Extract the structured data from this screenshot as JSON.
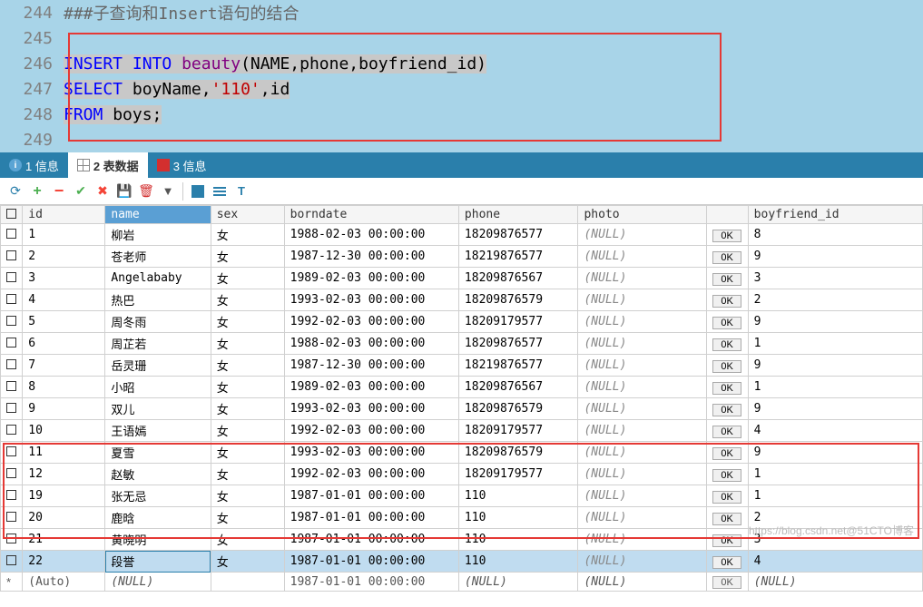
{
  "editor": {
    "lines": [
      {
        "num": "244",
        "tokens": [
          {
            "t": "###子查询和Insert语句的结合",
            "cls": "comment-gray"
          }
        ]
      },
      {
        "num": "245",
        "tokens": []
      },
      {
        "num": "246",
        "tokens": [
          {
            "t": "INSERT INTO",
            "cls": "kw-blue sel"
          },
          {
            "t": " ",
            "cls": "sel"
          },
          {
            "t": "beauty",
            "cls": "kw-purple sel"
          },
          {
            "t": "(NAME,phone,boyfriend_id)",
            "cls": "sel"
          }
        ]
      },
      {
        "num": "247",
        "tokens": [
          {
            "t": "SELECT",
            "cls": "kw-blue sel"
          },
          {
            "t": " boyName,",
            "cls": "sel"
          },
          {
            "t": "'110'",
            "cls": "kw-red sel"
          },
          {
            "t": ",id",
            "cls": "sel"
          }
        ]
      },
      {
        "num": "248",
        "tokens": [
          {
            "t": "FROM",
            "cls": "kw-blue sel"
          },
          {
            "t": " boys;",
            "cls": "sel"
          }
        ]
      },
      {
        "num": "249",
        "tokens": []
      }
    ]
  },
  "tabs": {
    "t1": "1 信息",
    "t2": "2 表数据",
    "t3": "3 信息"
  },
  "headers": {
    "id": "id",
    "name": "name",
    "sex": "sex",
    "borndate": "borndate",
    "phone": "phone",
    "photo": "photo",
    "boyfriend_id": "boyfriend_id"
  },
  "ok_label": "0K",
  "rows": [
    {
      "id": "1",
      "name": "柳岩",
      "sex": "女",
      "borndate": "1988-02-03 00:00:00",
      "phone": "18209876577",
      "photo": "(NULL)",
      "bf": "8"
    },
    {
      "id": "2",
      "name": "苍老师",
      "sex": "女",
      "borndate": "1987-12-30 00:00:00",
      "phone": "18219876577",
      "photo": "(NULL)",
      "bf": "9"
    },
    {
      "id": "3",
      "name": "Angelababy",
      "sex": "女",
      "borndate": "1989-02-03 00:00:00",
      "phone": "18209876567",
      "photo": "(NULL)",
      "bf": "3"
    },
    {
      "id": "4",
      "name": "热巴",
      "sex": "女",
      "borndate": "1993-02-03 00:00:00",
      "phone": "18209876579",
      "photo": "(NULL)",
      "bf": "2"
    },
    {
      "id": "5",
      "name": "周冬雨",
      "sex": "女",
      "borndate": "1992-02-03 00:00:00",
      "phone": "18209179577",
      "photo": "(NULL)",
      "bf": "9"
    },
    {
      "id": "6",
      "name": "周芷若",
      "sex": "女",
      "borndate": "1988-02-03 00:00:00",
      "phone": "18209876577",
      "photo": "(NULL)",
      "bf": "1"
    },
    {
      "id": "7",
      "name": "岳灵珊",
      "sex": "女",
      "borndate": "1987-12-30 00:00:00",
      "phone": "18219876577",
      "photo": "(NULL)",
      "bf": "9"
    },
    {
      "id": "8",
      "name": "小昭",
      "sex": "女",
      "borndate": "1989-02-03 00:00:00",
      "phone": "18209876567",
      "photo": "(NULL)",
      "bf": "1"
    },
    {
      "id": "9",
      "name": "双儿",
      "sex": "女",
      "borndate": "1993-02-03 00:00:00",
      "phone": "18209876579",
      "photo": "(NULL)",
      "bf": "9"
    },
    {
      "id": "10",
      "name": "王语嫣",
      "sex": "女",
      "borndate": "1992-02-03 00:00:00",
      "phone": "18209179577",
      "photo": "(NULL)",
      "bf": "4"
    },
    {
      "id": "11",
      "name": "夏雪",
      "sex": "女",
      "borndate": "1993-02-03 00:00:00",
      "phone": "18209876579",
      "photo": "(NULL)",
      "bf": "9"
    },
    {
      "id": "12",
      "name": "赵敏",
      "sex": "女",
      "borndate": "1992-02-03 00:00:00",
      "phone": "18209179577",
      "photo": "(NULL)",
      "bf": "1"
    },
    {
      "id": "19",
      "name": "张无忌",
      "sex": "女",
      "borndate": "1987-01-01 00:00:00",
      "phone": "110",
      "photo": "(NULL)",
      "bf": "1"
    },
    {
      "id": "20",
      "name": "鹿晗",
      "sex": "女",
      "borndate": "1987-01-01 00:00:00",
      "phone": "110",
      "photo": "(NULL)",
      "bf": "2"
    },
    {
      "id": "21",
      "name": "黄晓明",
      "sex": "女",
      "borndate": "1987-01-01 00:00:00",
      "phone": "110",
      "photo": "(NULL)",
      "bf": "3"
    },
    {
      "id": "22",
      "name": "段誉",
      "sex": "女",
      "borndate": "1987-01-01 00:00:00",
      "phone": "110",
      "photo": "(NULL)",
      "bf": "4",
      "selected": true
    }
  ],
  "auto_row": {
    "id": "(Auto)",
    "name": "(NULL)",
    "sex": "",
    "borndate": "1987-01-01 00:00:00",
    "phone": "(NULL)",
    "photo": "(NULL)",
    "bf": "(NULL)"
  },
  "watermark": "https://blog.csdn.net@51CTO博客"
}
